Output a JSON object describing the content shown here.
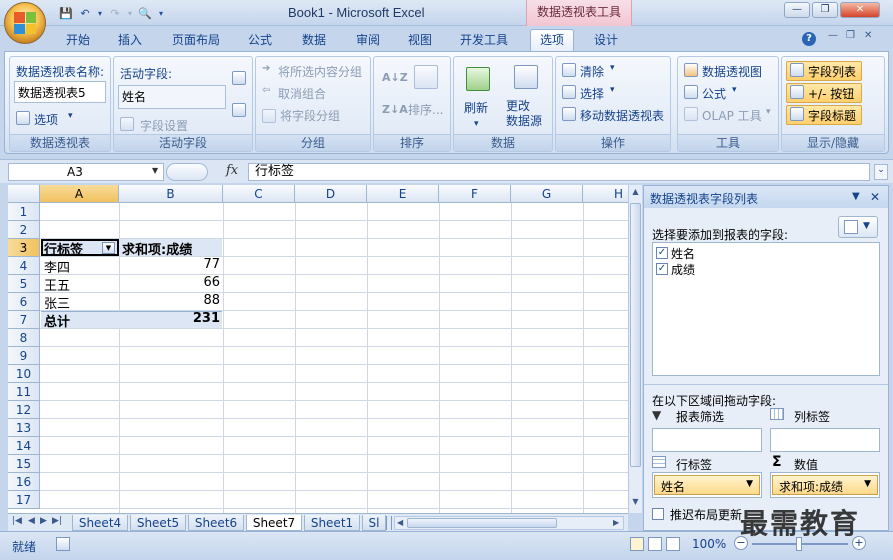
{
  "window": {
    "title": "Book1 - Microsoft Excel",
    "context_tool": "数据透视表工具",
    "min_glyph": "—",
    "max_glyph": "❐",
    "close_glyph": "✕"
  },
  "quick_access": [
    "save",
    "undo",
    "redo",
    "print-preview"
  ],
  "tabs": [
    "开始",
    "插入",
    "页面布局",
    "公式",
    "数据",
    "审阅",
    "视图",
    "开发工具",
    "选项",
    "设计"
  ],
  "active_tab": "选项",
  "help_glyph": "?",
  "ribbon": {
    "pivot_group": {
      "name_label": "数据透视表名称:",
      "name_value": "数据透视表5",
      "options_label": "选项",
      "group_label": "数据透视表"
    },
    "active_field_group": {
      "field_label": "活动字段:",
      "field_value": "姓名",
      "settings_label": "字段设置",
      "group_label": "活动字段"
    },
    "grouping_group": {
      "group_selection": "将所选内容分组",
      "ungroup": "取消组合",
      "group_field": "将字段分组",
      "group_label": "分组"
    },
    "sort_group": {
      "sort_label": "排序...",
      "group_label": "排序"
    },
    "data_group": {
      "refresh_label": "刷新",
      "change_source_label": "更改\n数据源",
      "group_label": "数据"
    },
    "actions_group": {
      "clear_label": "清除",
      "select_label": "选择",
      "move_label": "移动数据透视表",
      "group_label": "操作"
    },
    "tools_group": {
      "pivotchart_label": "数据透视图",
      "formulas_label": "公式",
      "olap_label": "OLAP 工具",
      "group_label": "工具"
    },
    "show_hide_group": {
      "field_list_label": "字段列表",
      "buttons_label": "+/- 按钮",
      "headers_label": "字段标题",
      "group_label": "显示/隐藏"
    }
  },
  "formula_bar": {
    "name_box": "A3",
    "fx": "fx",
    "content": "行标签"
  },
  "columns": [
    "A",
    "B",
    "C",
    "D",
    "E",
    "F",
    "G",
    "H"
  ],
  "rows": [
    "1",
    "2",
    "3",
    "4",
    "5",
    "6",
    "7",
    "8",
    "9",
    "10",
    "11",
    "12",
    "13",
    "14",
    "15",
    "16",
    "17"
  ],
  "pivot_table": {
    "header_row_label": "行标签",
    "header_value_label": "求和项:成绩",
    "entries": [
      {
        "name": "李四",
        "value": "77"
      },
      {
        "name": "王五",
        "value": "66"
      },
      {
        "name": "张三",
        "value": "88"
      }
    ],
    "total_label": "总计",
    "total_value": "231"
  },
  "sheet_tabs": [
    "Sheet4",
    "Sheet5",
    "Sheet6",
    "Sheet7",
    "Sheet1",
    "Sl"
  ],
  "active_sheet": "Sheet7",
  "status": {
    "ready": "就绪",
    "zoom": "100%"
  },
  "field_pane": {
    "title": "数据透视表字段列表",
    "choose_label": "选择要添加到报表的字段:",
    "fields": [
      {
        "name": "姓名",
        "checked": true
      },
      {
        "name": "成绩",
        "checked": true
      }
    ],
    "drag_label": "在以下区域间拖动字段:",
    "report_filter_label": "报表筛选",
    "column_labels_label": "列标签",
    "row_labels_label": "行标签",
    "values_label": "数值",
    "row_field": "姓名",
    "value_field": "求和项:成绩",
    "defer_label": "推迟布局更新"
  },
  "watermark": "最需教育"
}
